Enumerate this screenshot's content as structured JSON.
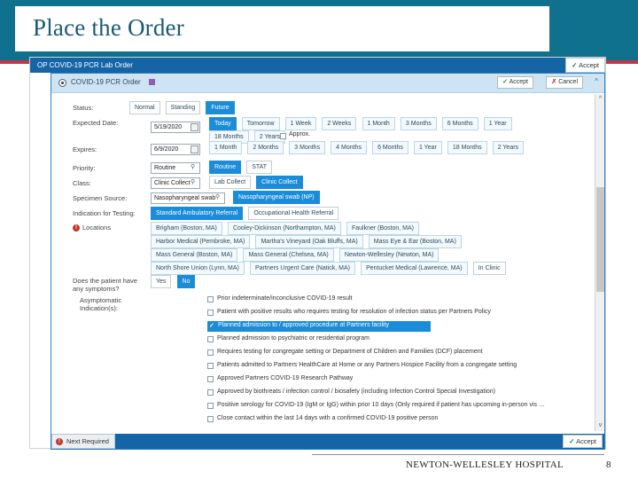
{
  "slide": {
    "title": "Place the Order",
    "footer_org": "NEWTON-WELLESLEY HOSPITAL",
    "page_number": "8",
    "colors": {
      "band": "#10718f",
      "accent_red": "#c0364a",
      "title_text": "#1a5a73"
    }
  },
  "window": {
    "title": "OP COVID-19 PCR Lab Order",
    "accept_label": "Accept",
    "order_name": "COVID-19 PCR Order",
    "accept_label_2": "Accept",
    "cancel_label": "Cancel",
    "collapse_icon": "chevron-up-icon"
  },
  "form": {
    "status": {
      "label": "Status:",
      "options": [
        "Normal",
        "Standing",
        "Future"
      ],
      "selected": "Future"
    },
    "expected_date": {
      "label": "Expected Date:",
      "value": "5/19/2020",
      "quick_row1": [
        "Today",
        "Tomorrow",
        "1 Week",
        "2 Weeks",
        "1 Month",
        "3 Months",
        "6 Months",
        "1 Year"
      ],
      "quick_row2": [
        "18 Months",
        "2 Years"
      ],
      "selected": "Today",
      "approx_label": "Approx.",
      "approx_checked": false
    },
    "expires": {
      "label": "Expires:",
      "value": "6/9/2020",
      "quick": [
        "1 Month",
        "2 Months",
        "3 Months",
        "4 Months",
        "6 Months",
        "1 Year",
        "18 Months",
        "2 Years"
      ]
    },
    "priority": {
      "label": "Priority:",
      "value": "Routine",
      "options": [
        "Routine",
        "STAT"
      ],
      "selected": "Routine"
    },
    "class": {
      "label": "Class:",
      "value": "Clinic Collect",
      "options": [
        "Lab Collect",
        "Clinic Collect"
      ],
      "selected": "Clinic Collect"
    },
    "specimen_source": {
      "label": "Specimen Source:",
      "value": "Nasopharyngeal swab",
      "options": [
        "Nasopharyngeal swab (NP)"
      ],
      "selected": "Nasopharyngeal swab (NP)"
    },
    "indication_for_testing": {
      "label": "Indication for Testing:",
      "options": [
        "Standard Ambulatory Referral",
        "Occupational Health Referral"
      ],
      "selected": "Standard Ambulatory Referral"
    },
    "locations": {
      "label": "Locations",
      "required_icon": "error-required-icon",
      "options": [
        "Brigham (Boston, MA)",
        "Cooley-Dickinson (Northampton, MA)",
        "Faulkner (Boston, MA)",
        "Harbor Medical (Pembroke, MA)",
        "Martha's Vineyard (Oak Bluffs, MA)",
        "Mass Eye & Ear (Boston, MA)",
        "Mass General (Boston, MA)",
        "Mass General (Chelsea, MA)",
        "Newton-Wellesley (Newton, MA)",
        "North Shore Union (Lynn, MA)",
        "Partners Urgent Care (Natick, MA)",
        "Pentucket Medical (Lawrence, MA)",
        "In Clinic"
      ]
    },
    "symptoms": {
      "label": "Does the patient have any symptoms?",
      "options": [
        "Yes",
        "No"
      ],
      "selected": "No"
    },
    "asymptomatic": {
      "label": "Asymptomatic Indication(s):",
      "items": [
        {
          "text": "Prior indeterminate/inconclusive COVID-19 result",
          "checked": false
        },
        {
          "text": "Patient with positive results who requires testing for resolution of infection status per Partners Policy",
          "checked": false
        },
        {
          "text": "Planned admission to / approved procedure at Partners facility",
          "checked": true
        },
        {
          "text": "Planned admission to psychiatric or residential program",
          "checked": false
        },
        {
          "text": "Requires testing for congregate setting or Department of Children and Families (DCF) placement",
          "checked": false
        },
        {
          "text": "Patients admitted to Partners HealthCare at Home or any Partners Hospice Facility from a congregate setting",
          "checked": false
        },
        {
          "text": "Approved Partners COVID-19 Research Pathway",
          "checked": false
        },
        {
          "text": "Approved by biothreats / infection control / biosafety (including Infection Control Special Investigation)",
          "checked": false
        },
        {
          "text": "Positive serology for COVID-19 (IgM or IgG) within prior 10 days (Only required if patient has upcoming in-person vis …",
          "checked": false
        },
        {
          "text": "Close contact within the last 14 days with a confirmed COVID-19 positive person",
          "checked": false
        }
      ]
    }
  },
  "statusbar": {
    "next_required": "Next Required",
    "accept_label": "Accept"
  }
}
